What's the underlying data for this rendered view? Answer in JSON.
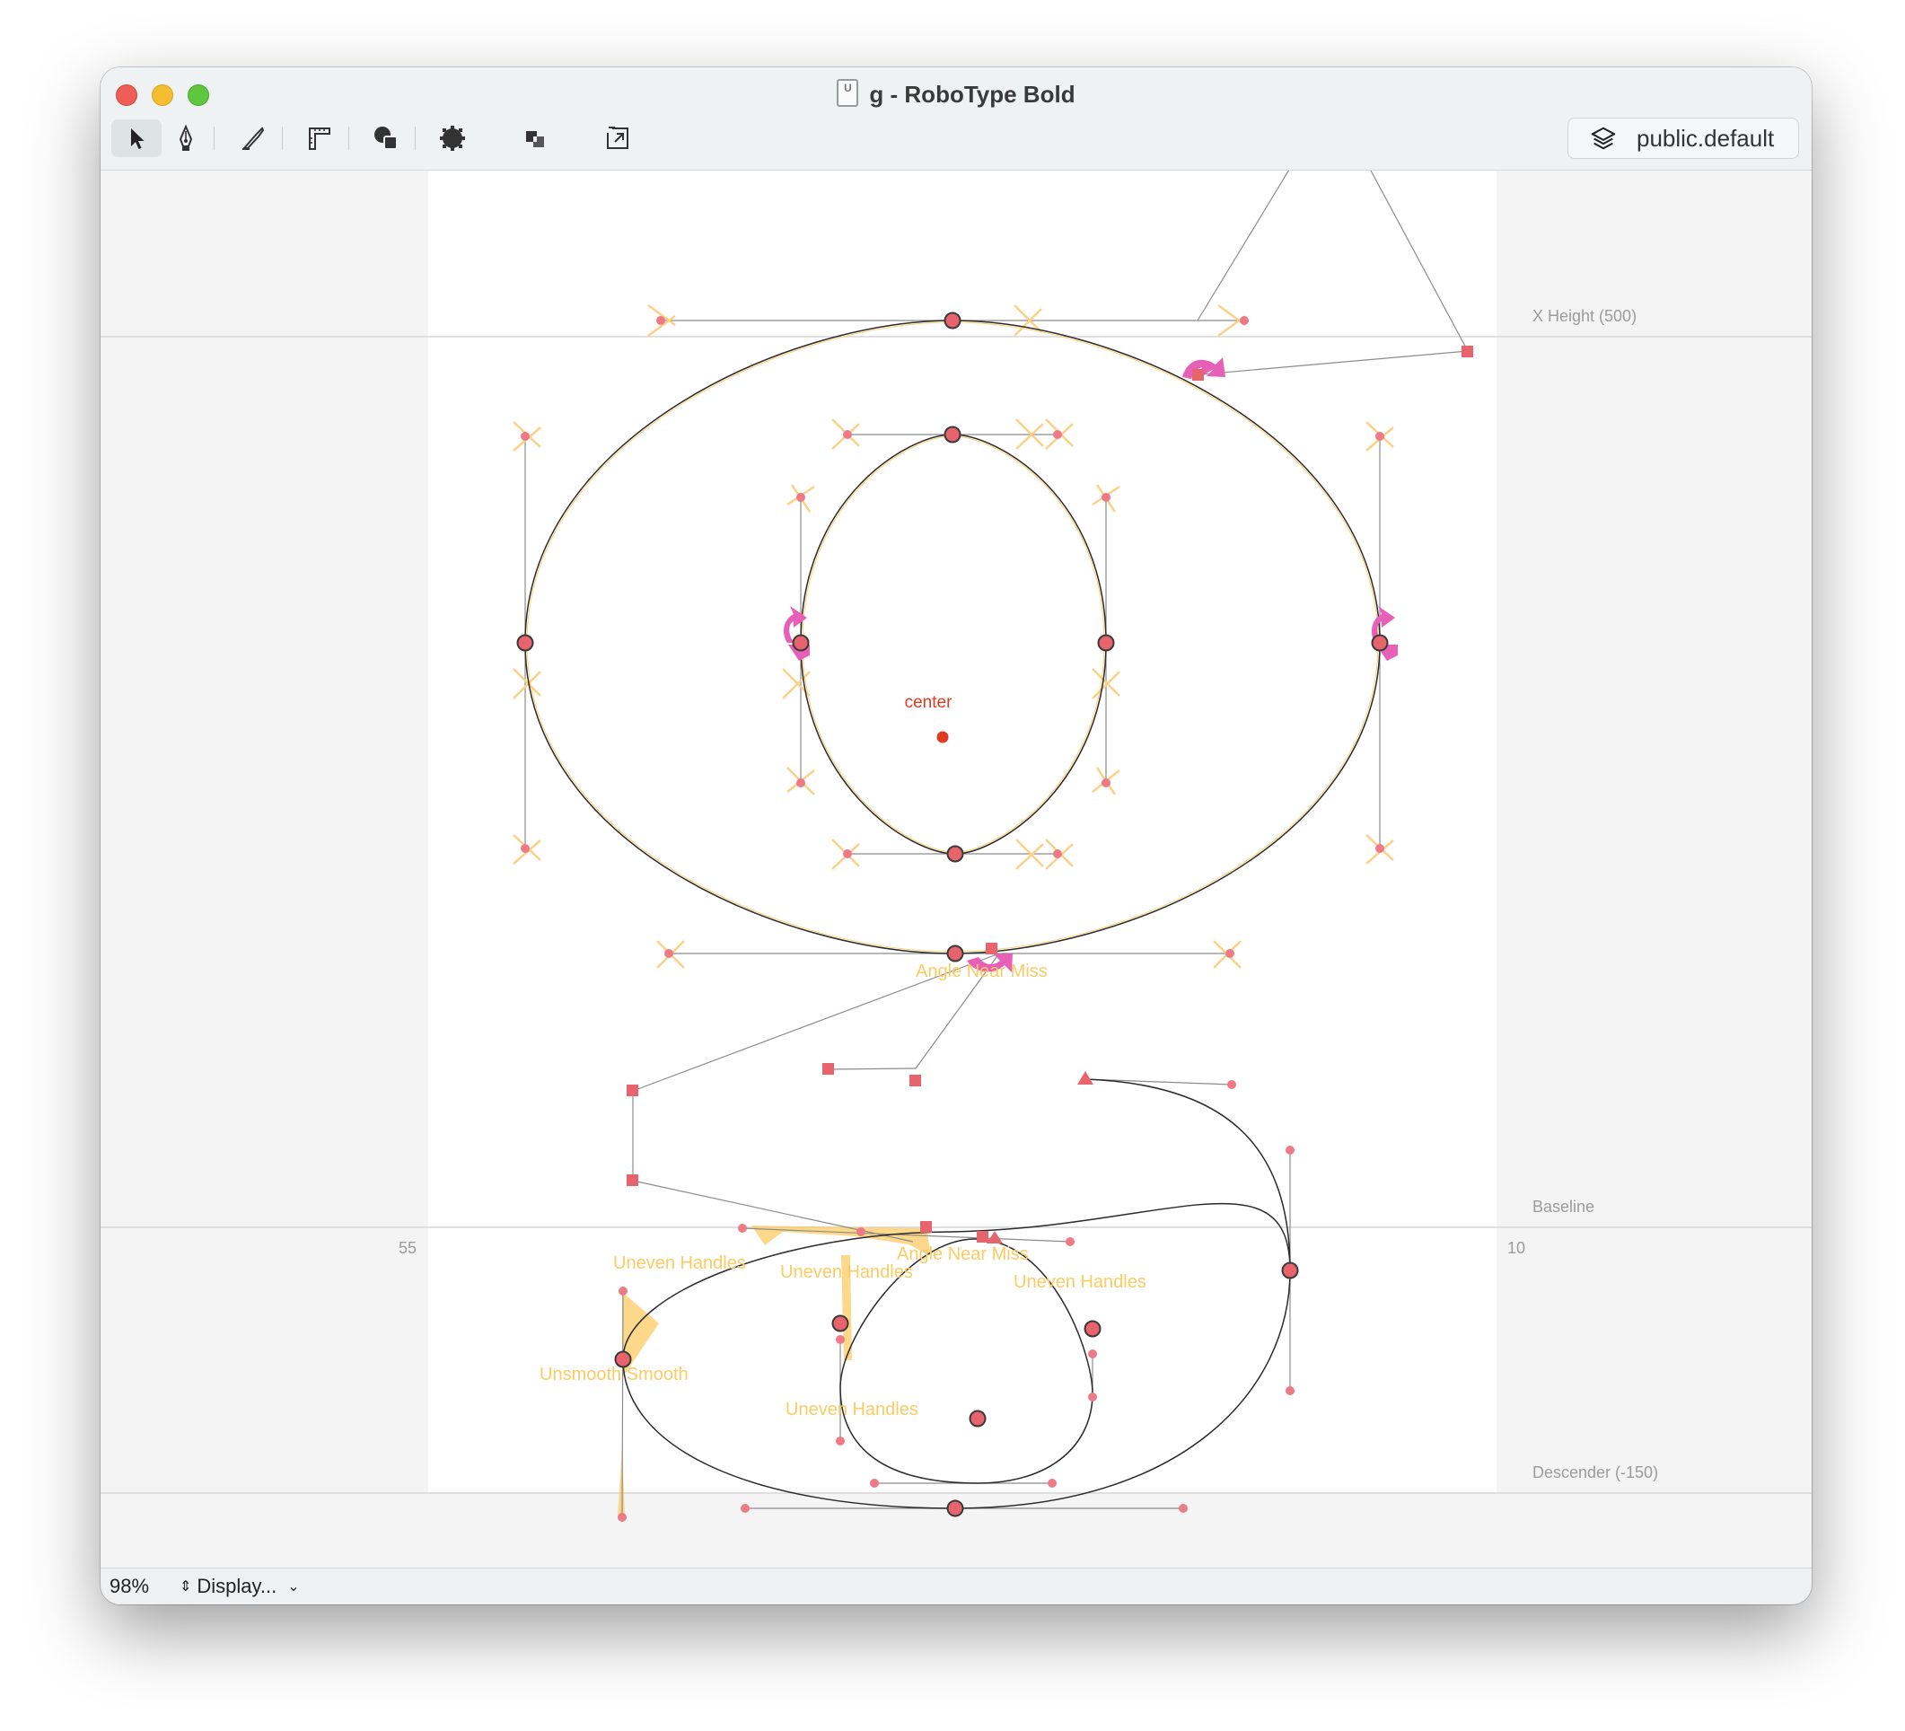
{
  "window": {
    "title": "g - RoboType Bold",
    "file_icon": "ufo-document-icon"
  },
  "toolbar": {
    "tools": [
      {
        "name": "select-tool",
        "icon": "arrow-cursor-icon",
        "active": true
      },
      {
        "name": "bezier-tool",
        "icon": "pen-nib-icon",
        "active": false
      },
      {
        "name": "knife-tool",
        "icon": "knife-icon",
        "active": false
      },
      {
        "name": "measure-tool",
        "icon": "ruler-icon",
        "active": false
      },
      {
        "name": "shape-tool",
        "icon": "shapes-icon",
        "active": false
      },
      {
        "name": "brush-tool",
        "icon": "blob-icon",
        "active": false
      },
      {
        "name": "layers-overlap-tool",
        "icon": "overlap-squares-icon",
        "active": false
      },
      {
        "name": "sidebearing-tool",
        "icon": "square-arrow-icon",
        "active": false
      }
    ],
    "layer_label": "public.default",
    "layer_icon": "layers-stack-icon"
  },
  "canvas": {
    "guidelines": {
      "x_height": "X Height (500)",
      "baseline": "Baseline",
      "descender": "Descender (-150)"
    },
    "margins": {
      "left": "55",
      "right": "10"
    },
    "anchor_label": "center",
    "annotations": [
      "Angle Near Miss",
      "Angle Near Miss",
      "Uneven Handles",
      "Uneven Handles",
      "Uneven Handles",
      "Uneven Handles",
      "Unsmooth Smooth"
    ],
    "colors": {
      "point": "#e8646d",
      "handle_point": "#ee7a86",
      "start_arrow": "#e85fb7",
      "warning": "#fccb63",
      "anchor": "#e23a1f",
      "outline": "#2a2a2a",
      "glyph_bg": "#ffffff",
      "canvas_bg": "#f4f4f4"
    }
  },
  "status": {
    "zoom": "98%",
    "display_menu": "Display..."
  }
}
